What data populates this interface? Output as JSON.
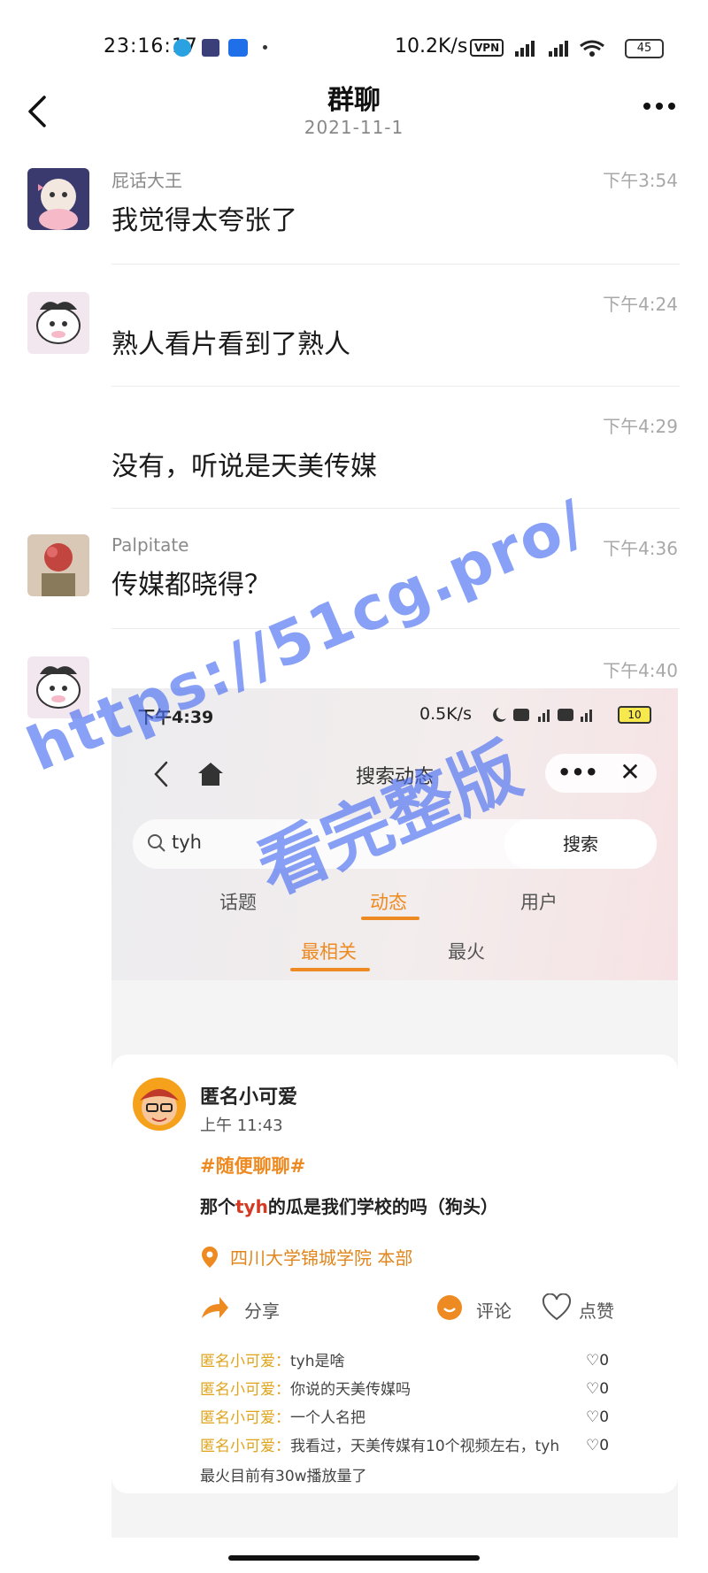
{
  "status_bar": {
    "time": "23:16:17",
    "network_speed": "10.2K/s",
    "vpn": "VPN",
    "battery": "45"
  },
  "header": {
    "title": "群聊",
    "date": "2021-11-1"
  },
  "messages": [
    {
      "sender": "屁话大王",
      "time": "下午3:54",
      "text": "我觉得太夸张了"
    },
    {
      "sender": "",
      "time": "下午4:24",
      "text": "熟人看片看到了熟人"
    },
    {
      "sender": "",
      "time": "下午4:29",
      "text": "没有，听说是天美传媒"
    },
    {
      "sender": "Palpitate",
      "time": "下午4:36",
      "text": "传媒都晓得？"
    },
    {
      "sender": "",
      "time": "下午4:40",
      "text": ""
    }
  ],
  "shared_screenshot": {
    "status_time": "下午4:39",
    "status_speed": "0.5K/s",
    "status_battery": "10",
    "title": "搜索动态",
    "search_query": "tyh",
    "search_button": "搜索",
    "tabs": [
      "话题",
      "动态",
      "用户"
    ],
    "active_tab": "动态",
    "sub_tabs": [
      "最相关",
      "最火"
    ],
    "active_sub_tab": "最相关",
    "post": {
      "author": "匿名小可爱",
      "time": "上午 11:43",
      "topic": "#随便聊聊#",
      "body_prefix": "那个",
      "body_highlight": "tyh",
      "body_suffix": "的瓜是我们学校的吗（狗头）",
      "location": "四川大学锦城学院 本部",
      "share_label": "分享",
      "comment_label": "评论",
      "like_label": "点赞",
      "comments": [
        {
          "user": "匿名小可爱：",
          "text": "tyh是啥",
          "likes": "0"
        },
        {
          "user": "匿名小可爱：",
          "text": "你说的天美传媒吗",
          "likes": "0"
        },
        {
          "user": "匿名小可爱：",
          "text": "一个人名把",
          "likes": "0"
        },
        {
          "user": "匿名小可爱：",
          "text": "我看过，天美传媒有10个视频左右，tyh最火目前有30w播放量了",
          "likes": "0"
        }
      ]
    }
  },
  "watermark": {
    "url": "https://51cg.pro/",
    "caption": "看完整版",
    "color": "#4a6ff2"
  },
  "colors": {
    "accent": "#ee8a22",
    "highlight": "#d43a24",
    "comment_user": "#e0a31c"
  }
}
